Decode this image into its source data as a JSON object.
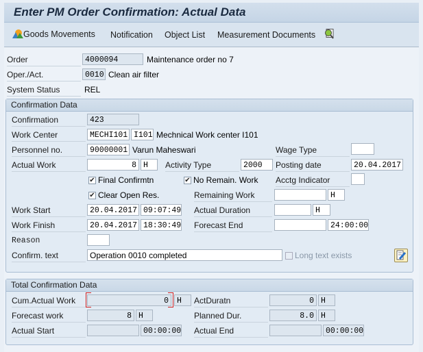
{
  "window": {
    "title": "Enter PM Order Confirmation: Actual Data"
  },
  "toolbar": {
    "items": [
      {
        "label": "Goods Movements",
        "icon": "goods-movements-icon"
      },
      {
        "label": "Notification"
      },
      {
        "label": "Object List"
      },
      {
        "label": "Measurement Documents"
      }
    ],
    "extra_icon": "find-document-icon"
  },
  "header": {
    "order_label": "Order",
    "order_value": "4000094",
    "order_desc": "Maintenance order no 7",
    "oper_label": "Oper./Act.",
    "oper_value": "0010",
    "oper_desc": "Clean air filter",
    "status_label": "System Status",
    "status_value": "REL"
  },
  "confirmation": {
    "title": "Confirmation Data",
    "confirmation_label": "Confirmation",
    "confirmation_value": "423",
    "work_center_label": "Work Center",
    "work_center_value": "MECHI101",
    "plant_value": "I101",
    "work_center_desc": "Mechnical Work center I101",
    "personnel_label": "Personnel no.",
    "personnel_value": "90000001",
    "personnel_name": "Varun Maheswari",
    "wage_type_label": "Wage Type",
    "wage_type_value": "",
    "actual_work_label": "Actual Work",
    "actual_work_value": "8",
    "actual_work_unit": "H",
    "activity_type_label": "Activity Type",
    "activity_type_value": "2000",
    "posting_date_label": "Posting date",
    "posting_date_value": "20.04.2017",
    "final_confirm_label": "Final Confirmtn",
    "final_confirm_checked": true,
    "no_remain_label": "No Remain. Work",
    "no_remain_checked": true,
    "acctg_label": "Acctg Indicator",
    "acctg_value": "",
    "clear_open_label": "Clear Open Res.",
    "clear_open_checked": true,
    "remaining_work_label": "Remaining Work",
    "remaining_work_value": "",
    "remaining_work_unit": "H",
    "work_start_label": "Work Start",
    "work_start_date": "20.04.2017",
    "work_start_time": "09:07:49",
    "actual_duration_label": "Actual Duration",
    "actual_duration_value": "",
    "actual_duration_unit": "H",
    "work_finish_label": "Work Finish",
    "work_finish_date": "20.04.2017",
    "work_finish_time": "18:30:49",
    "forecast_end_label": "Forecast End",
    "forecast_end_date": "",
    "forecast_end_time": "24:00:00",
    "reason_label": "Reason",
    "reason_value": "",
    "confirm_text_label": "Confirm. text",
    "confirm_text_value": "Operation 0010 completed",
    "long_text_label": "Long text exists",
    "long_text_checked": false
  },
  "totals": {
    "title": "Total Confirmation Data",
    "cum_actual_label": "Cum.Actual Work",
    "cum_actual_value": "0",
    "cum_actual_unit": "H",
    "act_duratn_label": "ActDuratn",
    "act_duratn_value": "0",
    "act_duratn_unit": "H",
    "forecast_work_label": "Forecast work",
    "forecast_work_value": "8",
    "forecast_work_unit": "H",
    "planned_dur_label": "Planned Dur.",
    "planned_dur_value": "8.0",
    "planned_dur_unit": "H",
    "actual_start_label": "Actual Start",
    "actual_start_date": "",
    "actual_start_time": "00:00:00",
    "actual_end_label": "Actual End",
    "actual_end_date": "",
    "actual_end_time": "00:00:00"
  }
}
